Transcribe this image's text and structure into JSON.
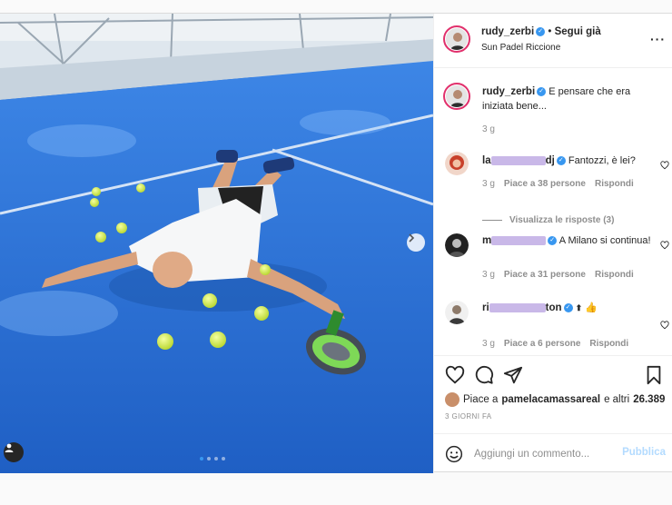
{
  "post": {
    "author": "rudy_zerbi",
    "follow_status": "Segui già",
    "location": "Sun Padel Riccione",
    "caption": "E pensare che era iniziata bene...",
    "caption_time": "3 g",
    "carousel": {
      "total": 4,
      "active": 1
    }
  },
  "comments": [
    {
      "user_visible_prefix": "la",
      "user_visible_suffix": "dj",
      "text": "Fantozzi, è lei?",
      "time": "3 g",
      "likes": "Piace a 38 persone",
      "reply": "Rispondi",
      "view_replies": "Visualizza le risposte (3)"
    },
    {
      "user_visible_prefix": "m",
      "user_visible_suffix": "",
      "text": "A Milano si continua!",
      "time": "3 g",
      "likes": "Piace a 31 persone",
      "reply": "Rispondi"
    },
    {
      "user_visible_prefix": "ri",
      "user_visible_suffix": "ton",
      "text": "👍",
      "time": "3 g",
      "likes": "Piace a 6 persone",
      "reply": "Rispondi"
    }
  ],
  "likes_bar": {
    "prefix": "Piace a",
    "liker": "pamelacamassareal",
    "suffix": "e altri",
    "count": "26.389"
  },
  "post_date": "3 GIORNI FA",
  "comment_box": {
    "placeholder": "Aggiungi un commento...",
    "publish_label": "Pubblica"
  },
  "colors": {
    "accent": "#3897f0",
    "court": "#2a6fd6",
    "publish_disabled": "#b3dbff"
  }
}
